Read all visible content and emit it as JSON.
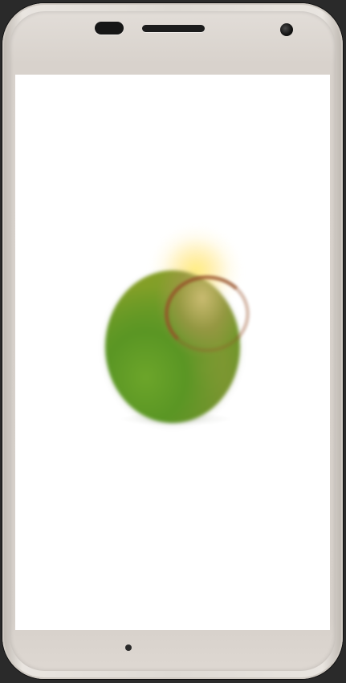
{
  "device": {
    "frame": "smartphone",
    "screen_background": "#ffffff",
    "frame_color": "#dedad4"
  },
  "icons": {
    "earpiece": "speaker-grille-icon",
    "sensor": "proximity-sensor-icon",
    "camera": "front-camera-icon",
    "home": "home-dot-icon"
  },
  "screen": {
    "content": "splash-animation",
    "colors": {
      "orb_green": "#6d9c27",
      "glow_yellow": "#ffec78",
      "ring_brown": "#964f28"
    }
  }
}
